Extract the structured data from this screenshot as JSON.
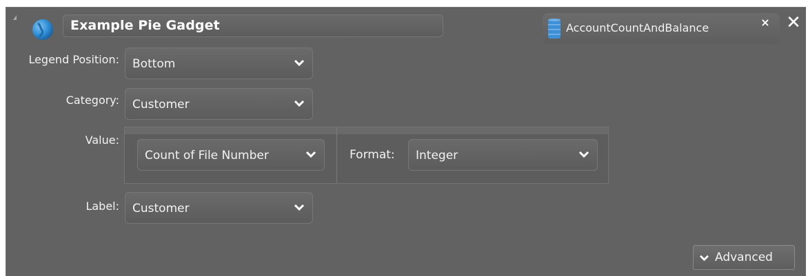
{
  "header": {
    "title": "Example Pie Gadget",
    "data_source": "AccountCountAndBalance",
    "data_source_close": "×",
    "close": "✕"
  },
  "fields": {
    "legend_position": {
      "label": "Legend Position:",
      "value": "Bottom"
    },
    "category": {
      "label": "Category:",
      "value": "Customer"
    },
    "value": {
      "label": "Value:",
      "aggregate": "Count of File Number",
      "format_label": "Format:",
      "format_value": "Integer"
    },
    "label": {
      "label": "Label:",
      "value": "Customer"
    }
  },
  "advanced_button": "Advanced",
  "icons": {
    "collapse": "collapse-arrow-icon",
    "gadget": "globe-icon",
    "data_source": "database-icon",
    "dropdown": "chevron-down-icon"
  },
  "colors": {
    "panel_bg": "#626262",
    "text": "#f2f2f2",
    "accent_blue": "#2f8ed6"
  }
}
